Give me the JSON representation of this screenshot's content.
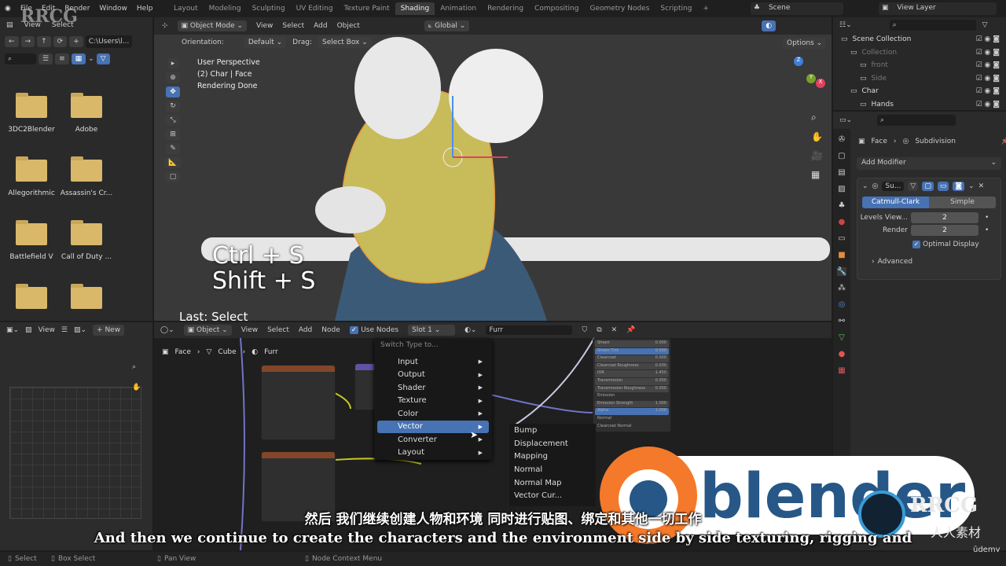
{
  "topbar": {
    "menus": [
      "File",
      "Edit",
      "Render",
      "Window",
      "Help"
    ],
    "workspaces": [
      "Layout",
      "Modeling",
      "Sculpting",
      "UV Editing",
      "Texture Paint",
      "Shading",
      "Animation",
      "Rendering",
      "Compositing",
      "Geometry Nodes",
      "Scripting",
      "+"
    ],
    "active_workspace": "Shading",
    "scene": "Scene",
    "view_layer": "View Layer"
  },
  "file_browser": {
    "menus": [
      "View",
      "Select"
    ],
    "path": "C:\\Users\\l...",
    "folders": [
      "3DC2Blender",
      "Adobe",
      "Allegorithmic",
      "Assassin's Cr...",
      "Battlefield V",
      "Call of Duty ...",
      "",
      ""
    ]
  },
  "viewport": {
    "mode": "Object Mode",
    "menus": [
      "View",
      "Select",
      "Add",
      "Object"
    ],
    "transform": "Global",
    "orientation_label": "Orientation:",
    "orientation": "Default",
    "drag_label": "Drag:",
    "drag": "Select Box",
    "options": "Options",
    "overlay_lines": [
      "User Perspective",
      "(2) Char | Face",
      "Rendering Done"
    ],
    "shortcut_lines": [
      "Ctrl + S",
      "Shift + S"
    ],
    "last_op": "Last: Select",
    "gizmo": {
      "z": "Z",
      "y": "Y",
      "x": "X"
    }
  },
  "outliner": {
    "items": [
      {
        "name": "Scene Collection",
        "level": 0
      },
      {
        "name": "Collection",
        "level": 1
      },
      {
        "name": "front",
        "level": 2
      },
      {
        "name": "Side",
        "level": 2
      },
      {
        "name": "Char",
        "level": 1
      },
      {
        "name": "Hands",
        "level": 2
      }
    ]
  },
  "properties": {
    "breadcrumb": [
      "Face",
      "Subdivision"
    ],
    "add_modifier": "Add Modifier",
    "modifier_name": "Su...",
    "tabs": [
      "Catmull-Clark",
      "Simple"
    ],
    "active_tab": "Catmull-Clark",
    "levels_viewport_label": "Levels View...",
    "levels_viewport": "2",
    "render_label": "Render",
    "render": "2",
    "optimal_display": "Optimal Display",
    "optimal_display_checked": true,
    "advanced": "Advanced"
  },
  "image_editor": {
    "view": "View",
    "new": "New"
  },
  "node_editor": {
    "object": "Object",
    "menus": [
      "View",
      "Select",
      "Add",
      "Node"
    ],
    "use_nodes": "Use Nodes",
    "slot": "Slot 1",
    "material": "Furr",
    "breadcrumb": [
      "Face",
      "Cube",
      "Furr"
    ],
    "switch_placeholder": "Switch Type to...",
    "menu_items": [
      "Input",
      "Output",
      "Shader",
      "Texture",
      "Color",
      "Vector",
      "Converter",
      "Layout"
    ],
    "active_item": "Vector",
    "submenu": [
      "Bump",
      "Displacement",
      "Mapping",
      "Normal",
      "Normal Map",
      "Vector Cur..."
    ],
    "bsdf_rows": [
      [
        "Sheen",
        "0.000"
      ],
      [
        "Sheen Tint",
        "0.500"
      ],
      [
        "Clearcoat",
        "0.000"
      ],
      [
        "Clearcoat Roughness",
        "0.030"
      ],
      [
        "IOR",
        "1.450"
      ],
      [
        "Transmission",
        "0.000"
      ],
      [
        "Transmission Roughness",
        "0.000"
      ],
      [
        "Emission",
        ""
      ],
      [
        "Emission Strength",
        "1.000"
      ],
      [
        "Alpha",
        "1.000"
      ],
      [
        "Normal",
        ""
      ],
      [
        "Clearcoat Normal",
        ""
      ]
    ]
  },
  "subtitles": {
    "zh": "然后 我们继续创建人物和环境 同时进行贴图、绑定和其他一切工作",
    "en": "And then we continue to create the characters and the environment side by side texturing, rigging and"
  },
  "watermarks": {
    "rrcg": "RRCG",
    "rrcg_cn": "人人素材",
    "udemy": "ūdemy",
    "blender": "blender"
  },
  "statusbar": [
    "Select",
    "Box Select",
    "Pan View",
    "Node Context Menu"
  ],
  "colors": {
    "accent": "#4772b3",
    "folder": "#d9b86a",
    "blender_orange": "#f5792a",
    "blender_blue": "#265787"
  }
}
